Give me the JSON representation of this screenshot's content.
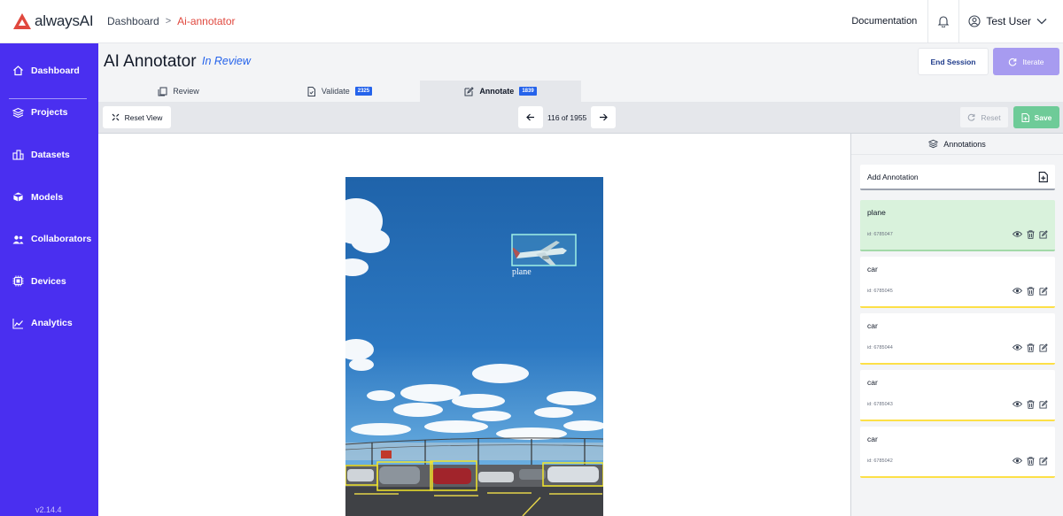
{
  "brand": {
    "logo_text": "alwaysAI",
    "accent": "#e0483e",
    "sidebar_color": "#4a2ff0"
  },
  "breadcrumb": {
    "home": "Dashboard",
    "separator": ">",
    "current": "Ai-annotator"
  },
  "topbar": {
    "documentation": "Documentation",
    "user_name": "Test User"
  },
  "sidebar": {
    "items": [
      {
        "label": "Dashboard",
        "icon": "home-icon"
      },
      {
        "label": "Projects",
        "icon": "layers-icon"
      },
      {
        "label": "Datasets",
        "icon": "datasets-icon"
      },
      {
        "label": "Models",
        "icon": "cube-icon"
      },
      {
        "label": "Collaborators",
        "icon": "users-icon"
      },
      {
        "label": "Devices",
        "icon": "chip-icon"
      },
      {
        "label": "Analytics",
        "icon": "chart-line-icon"
      }
    ],
    "version": "v2.14.4"
  },
  "header": {
    "title": "AI Annotator",
    "status": "In Review",
    "end_session": "End Session",
    "iterate": "Iterate"
  },
  "tabs": [
    {
      "label": "Review",
      "badge": ""
    },
    {
      "label": "Validate",
      "badge": "2325"
    },
    {
      "label": "Annotate",
      "badge": "1839"
    }
  ],
  "toolbar": {
    "reset_view": "Reset View",
    "pager": "116 of 1955",
    "reset": "Reset",
    "save": "Save"
  },
  "canvas": {
    "box_label_plane": "plane"
  },
  "panel": {
    "title": "Annotations",
    "add_annotation": "Add Annotation",
    "annotations": [
      {
        "label": "plane",
        "id": "id: 6785047"
      },
      {
        "label": "car",
        "id": "id: 6785045"
      },
      {
        "label": "car",
        "id": "id: 6785044"
      },
      {
        "label": "car",
        "id": "id: 6785043"
      },
      {
        "label": "car",
        "id": "id: 6785042"
      }
    ]
  }
}
